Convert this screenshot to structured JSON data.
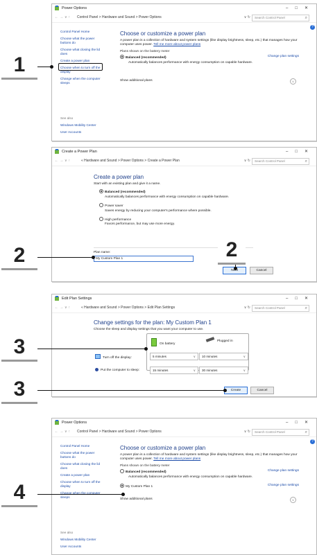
{
  "colors": {
    "link": "#1a4aa8",
    "heading": "#1e3f8a"
  },
  "callouts": {
    "c1": "1",
    "c2a": "2",
    "c2b": "2",
    "c3a": "3",
    "c3b": "3",
    "c4": "4"
  },
  "w1": {
    "title": "Power Options",
    "breadcrumb": "Control Panel  >  Hardware and Sound  >  Power Options",
    "search_placeholder": "Search Control Panel",
    "sidebar": [
      "Control Panel Home",
      "Choose what the power buttons do",
      "Choose what closing the lid does",
      "Create a power plan",
      "Choose when to turn off the display",
      "Change when the computer sleeps"
    ],
    "see_also": "See also",
    "see_also_links": [
      "Windows Mobility Center",
      "User Accounts"
    ],
    "heading": "Choose or customize a power plan",
    "intro": "A power plan is a collection of hardware and system settings (like display brightness, sleep, etc.) that manages how your computer uses power.",
    "intro_link": "Tell me more about power plans",
    "group": "Plans shown on the battery meter",
    "plan1": "Balanced (recommended)",
    "plan1_link": "Change plan settings",
    "plan1_desc": "Automatically balances performance with energy consumption on capable hardware.",
    "show_additional": "Show additional plans"
  },
  "w2": {
    "title": "Create a Power Plan",
    "breadcrumb": "«  Hardware and Sound  >  Power Options  >  Create a Power Plan",
    "search_placeholder": "Search Control Panel",
    "heading": "Create a power plan",
    "subheading": "Start with an existing plan and give it a name.",
    "opt1": "Balanced (recommended)",
    "opt1_desc": "Automatically balances performance with energy consumption on capable hardware.",
    "opt2": "Power saver",
    "opt2_desc": "Saves energy by reducing your computer's performance where possible.",
    "opt3": "High performance",
    "opt3_desc": "Favors performance, but may use more energy.",
    "plan_name_label": "Plan name:",
    "plan_name_value": "My Custom Plan 1",
    "next": "Next",
    "cancel": "Cancel"
  },
  "w3": {
    "title": "Edit Plan Settings",
    "breadcrumb": "«  Hardware and Sound  >  Power Options  >  Edit Plan Settings",
    "search_placeholder": "Search Control Panel",
    "heading": "Change settings for the plan: My Custom Plan 1",
    "subheading": "Choose the sleep and display settings that you want your computer to use.",
    "on_battery": "On battery",
    "plugged_in": "Plugged in",
    "row1": "Turn off the display:",
    "row1_bat": "5 minutes",
    "row1_plug": "10 minutes",
    "row2": "Put the computer to sleep:",
    "row2_bat": "15 minutes",
    "row2_plug": "30 minutes",
    "create": "Create",
    "cancel": "Cancel"
  },
  "w4": {
    "title": "Power Options",
    "breadcrumb": "Control Panel  >  Hardware and Sound  >  Power Options",
    "search_placeholder": "Search Control Panel",
    "sidebar": [
      "Control Panel Home",
      "Choose what the power buttons do",
      "Choose what closing the lid does",
      "Create a power plan",
      "Choose when to turn off the display",
      "Change when the computer sleeps"
    ],
    "see_also": "See also",
    "see_also_links": [
      "Windows Mobility Center",
      "User Accounts"
    ],
    "heading": "Choose or customize a power plan",
    "intro": "A power plan is a collection of hardware and system settings (like display brightness, sleep, etc.) that manages how your computer uses power.",
    "intro_link": "Tell me more about power plans",
    "group": "Plans shown on the battery meter",
    "plan1": "Balanced (recommended)",
    "plan1_link": "Change plan settings",
    "plan1_desc": "Automatically balances performance with energy consumption on capable hardware.",
    "plan2": "My Custom Plan 1",
    "plan2_link": "Change plan settings",
    "show_additional": "Show additional plans"
  }
}
